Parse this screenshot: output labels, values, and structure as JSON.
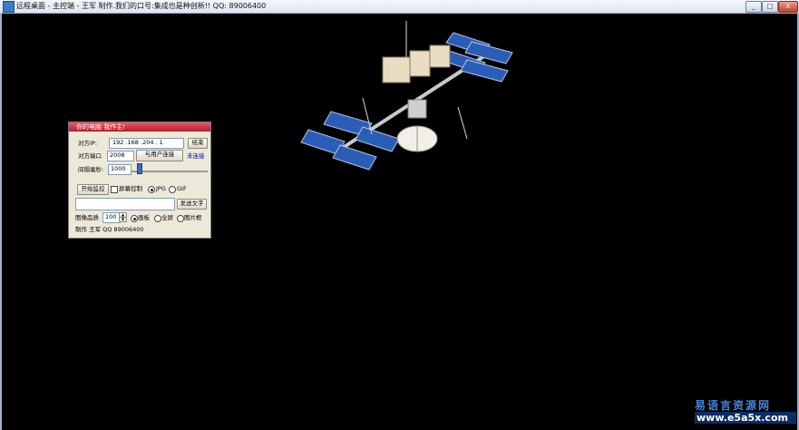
{
  "window": {
    "title": "远程桌面 - 主控端 - 王军 制作.我们的口号:集成也是种创新!! QQ: 89006400",
    "minimize_label": "_",
    "maximize_label": "□",
    "close_label": "X"
  },
  "dialog": {
    "title": "你的电脑 我作主!",
    "ip_label": "对方IP:",
    "ip_value": "192 .168 .204 . 1",
    "end_button": "结束",
    "port_label": "对方端口",
    "port_value": "2008",
    "connect_button": "与用户连接",
    "status_text": "未连接",
    "interval_label": "间隔毫秒:",
    "interval_value": "1000",
    "interval_level": 0.08,
    "start_button": "开始监控",
    "mouse_control_label": "屏幕控制",
    "mouse_control_checked": false,
    "format_options": [
      "JPG",
      "GIF"
    ],
    "format_selected": "JPG",
    "message_value": "",
    "send_button": "发送文字",
    "quality_label": "图像品质",
    "quality_value": "100",
    "spin_up": "▲",
    "spin_down": "▼",
    "view_options": [
      "画板",
      "全屏",
      "图片框"
    ],
    "view_selected": "画板",
    "author_text": "制作 王军  QQ 89006400"
  },
  "watermark": {
    "line1": "易语言资源网",
    "line2": "www.e5a5x.com"
  }
}
